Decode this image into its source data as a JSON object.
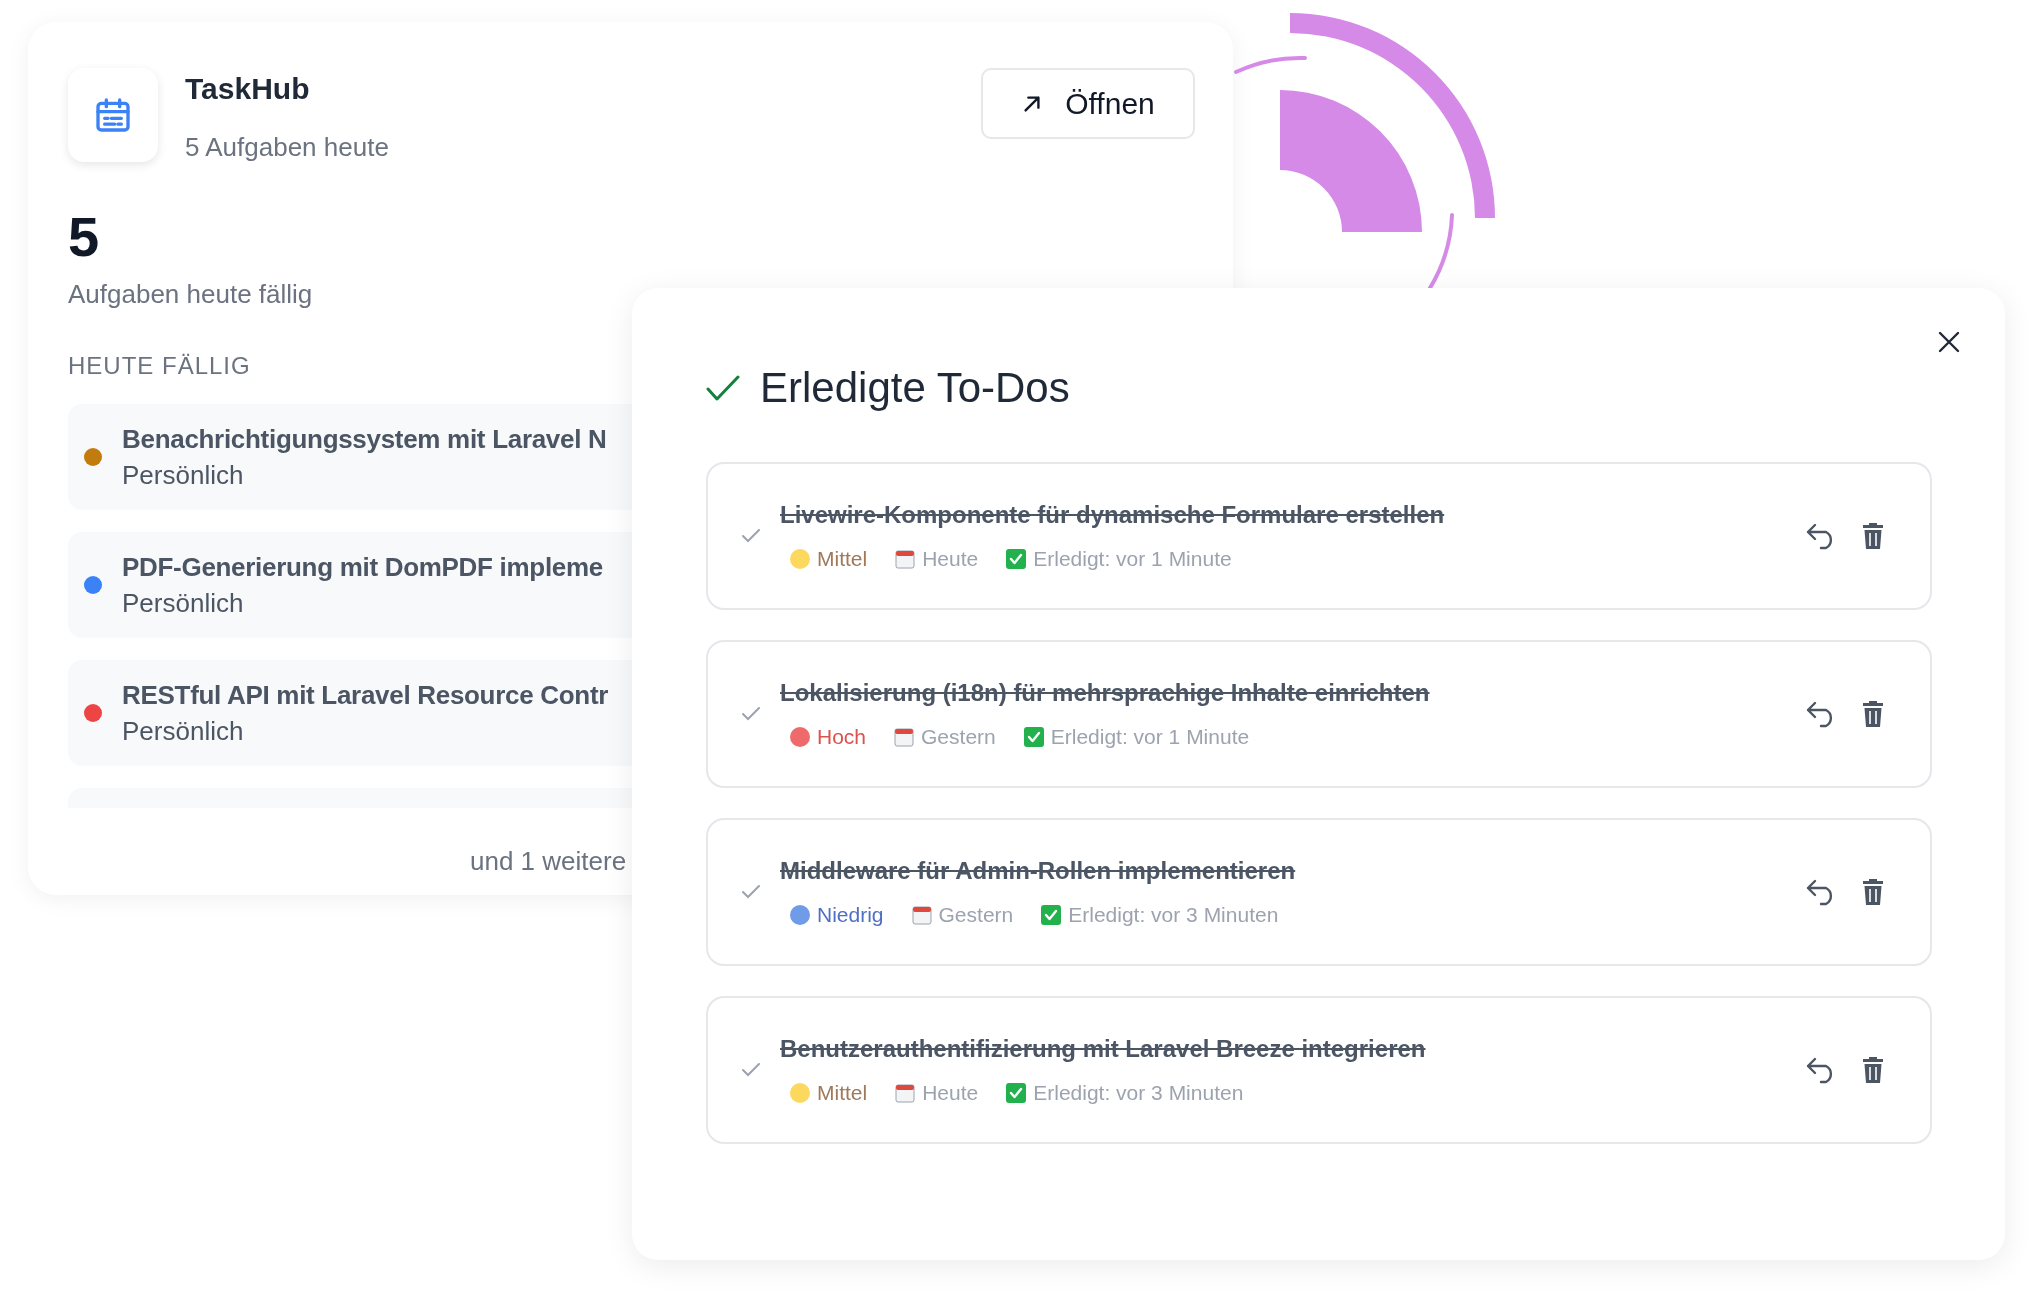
{
  "app": {
    "name": "TaskHub",
    "subtitle": "5 Aufgaben heute",
    "open_button": "Öffnen"
  },
  "summary": {
    "count": "5",
    "label": "Aufgaben heute fällig"
  },
  "due_today": {
    "heading": "HEUTE FÄLLIG",
    "items": [
      {
        "title": "Benachrichtigungssystem mit Laravel N",
        "category": "Persönlich",
        "color": "#c27c0e"
      },
      {
        "title": "PDF-Generierung mit DomPDF impleme",
        "category": "Persönlich",
        "color": "#3b82f6"
      },
      {
        "title": "RESTful API mit Laravel Resource Contr",
        "category": "Persönlich",
        "color": "#ef4444"
      }
    ],
    "more": "und 1 weitere"
  },
  "done_dialog": {
    "title": "Erledigte To-Dos",
    "items": [
      {
        "title": "Livewire-Komponente für dynamische Formulare erstellen",
        "priority": {
          "label": "Mittel",
          "kind": "medium",
          "color": "#fcd95e"
        },
        "due": "Heute",
        "completed": "Erledigt: vor 1 Minute"
      },
      {
        "title": "Lokalisierung (i18n) für mehrsprachige Inhalte einrichten",
        "priority": {
          "label": "Hoch",
          "kind": "high",
          "color": "#ef6b6b"
        },
        "due": "Gestern",
        "completed": "Erledigt: vor 1 Minute"
      },
      {
        "title": "Middleware für Admin-Rollen implementieren",
        "priority": {
          "label": "Niedrig",
          "kind": "low",
          "color": "#6f9be8"
        },
        "due": "Gestern",
        "completed": "Erledigt: vor 3 Minuten"
      },
      {
        "title": "Benutzerauthentifizierung mit Laravel Breeze integrieren",
        "priority": {
          "label": "Mittel",
          "kind": "medium",
          "color": "#fcd95e"
        },
        "due": "Heute",
        "completed": "Erledigt: vor 3 Minuten"
      }
    ]
  }
}
